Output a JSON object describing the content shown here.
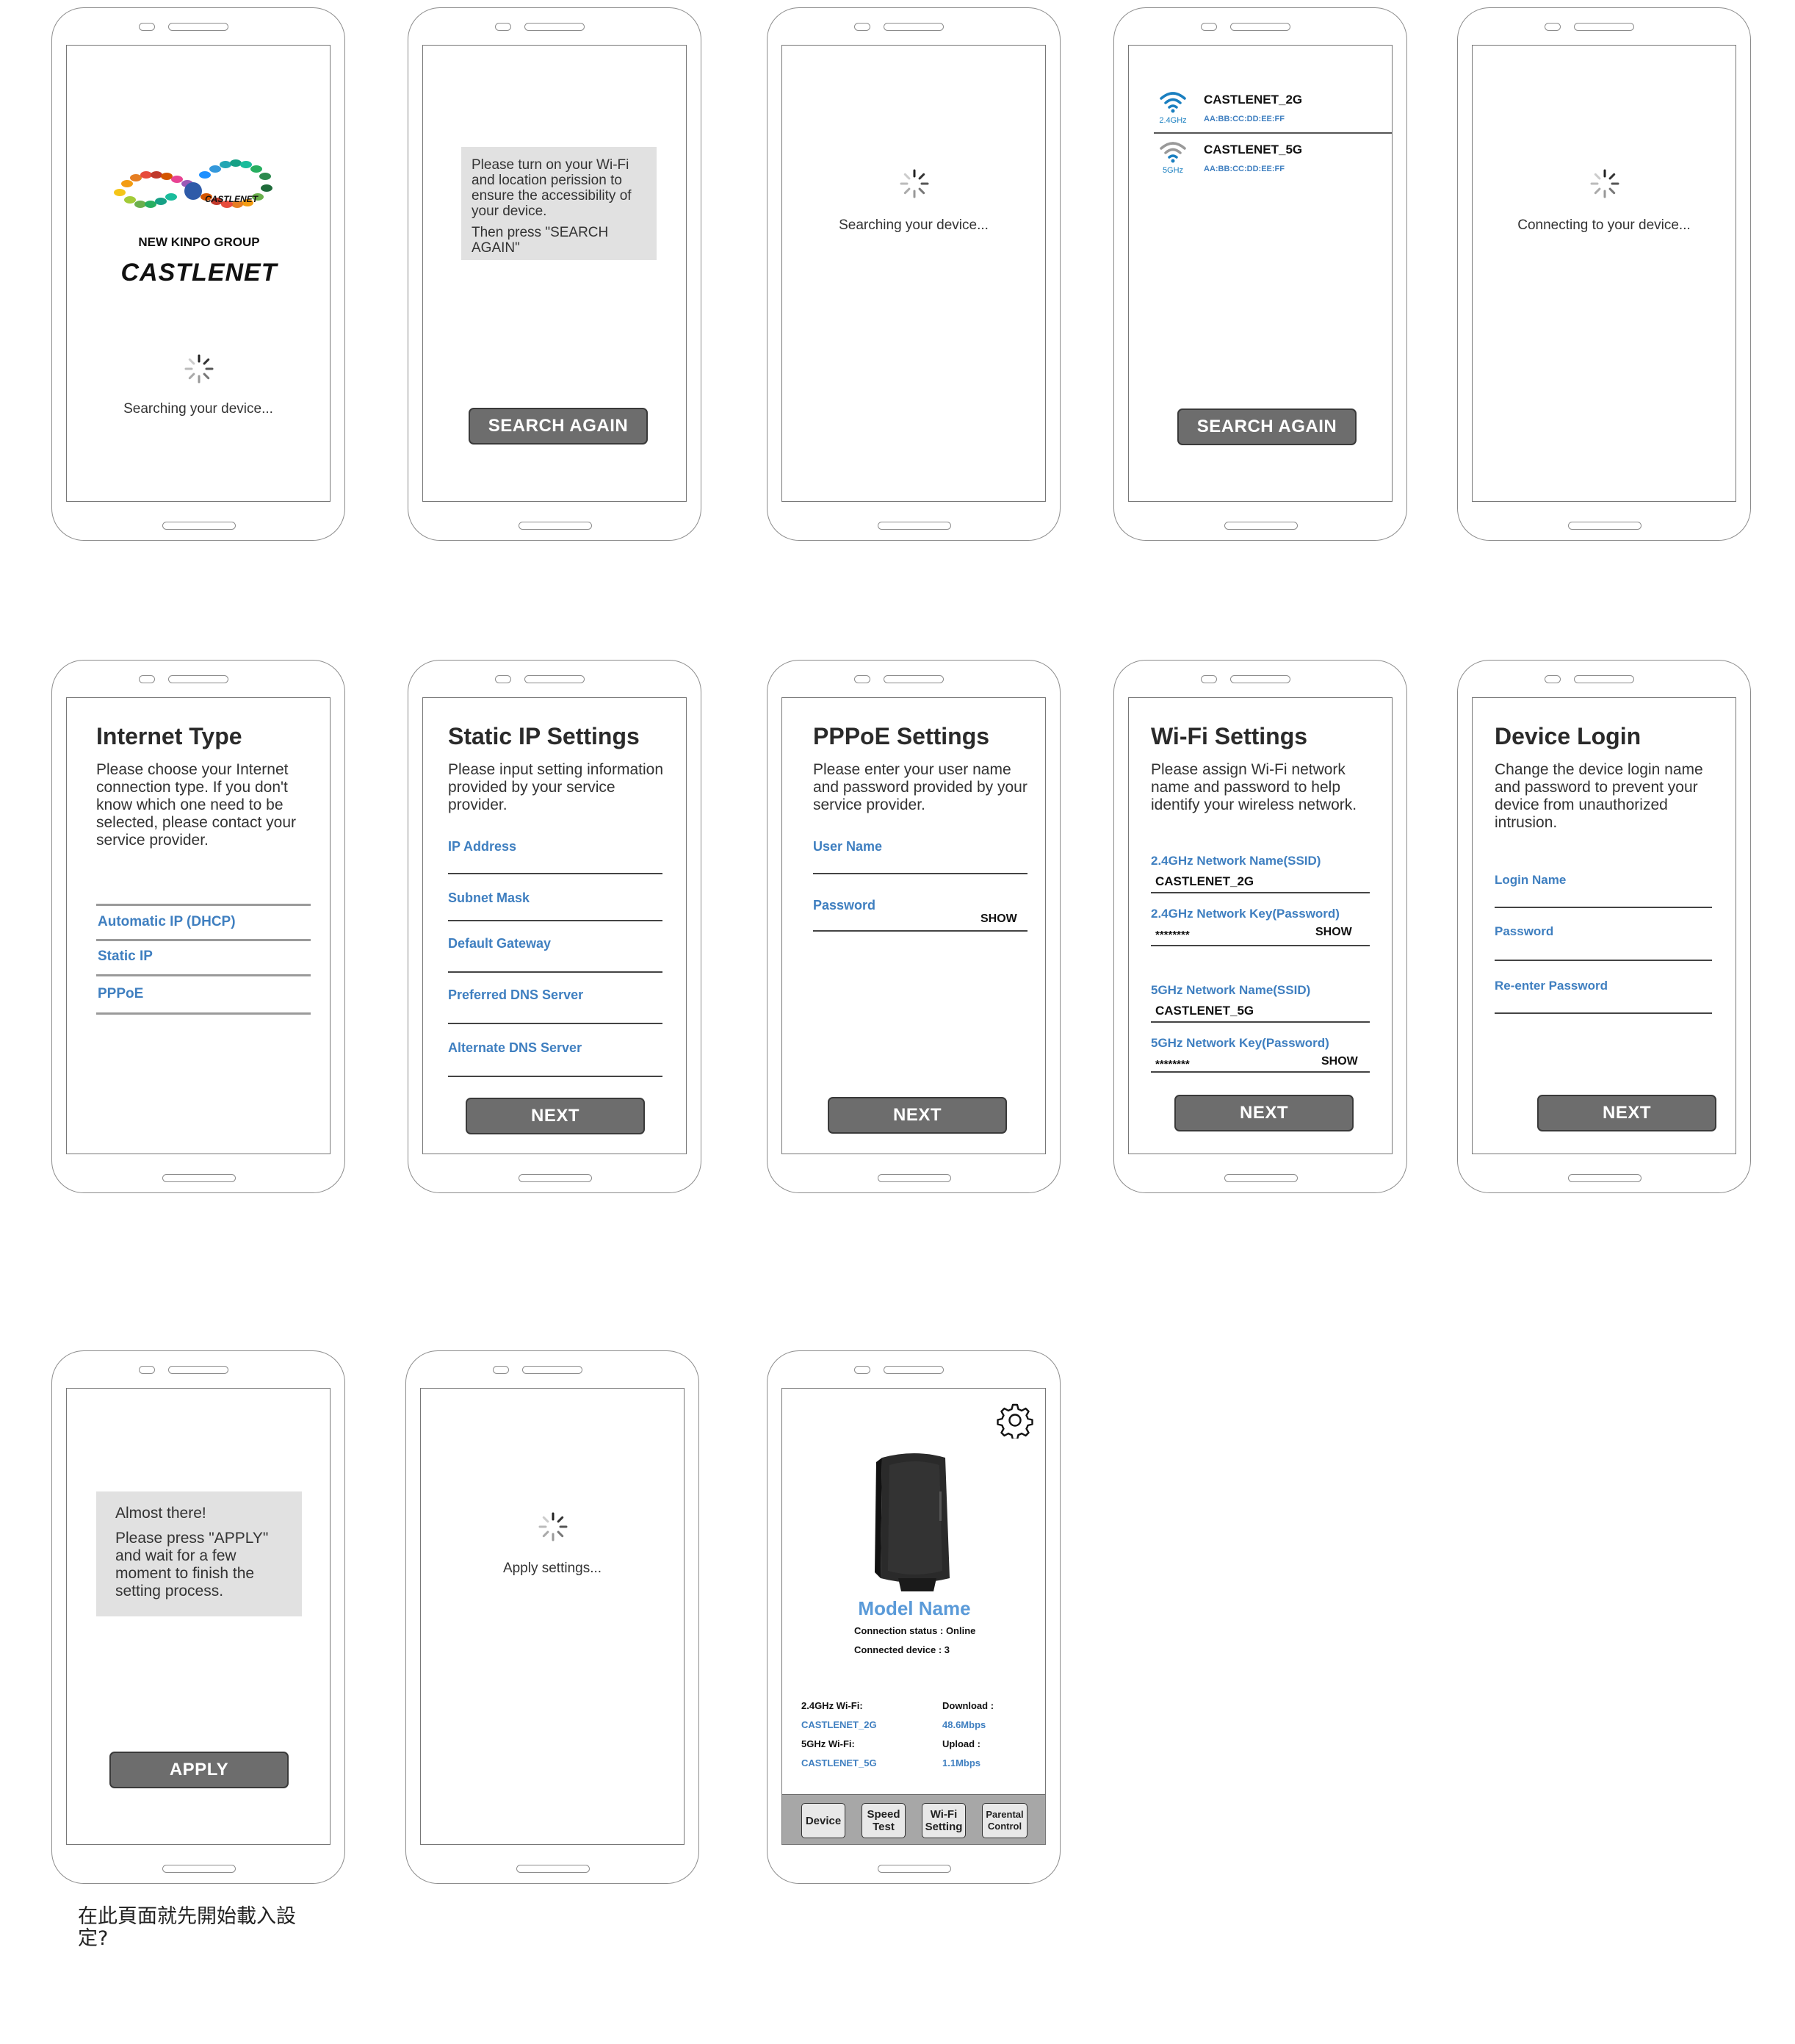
{
  "splash": {
    "logo_group_text": "NEW KINPO GROUP",
    "logo_brand_text": "CASTLENET",
    "logo_small_text": "CASTLENET",
    "status": "Searching your device..."
  },
  "permission": {
    "message": "Please turn on your Wi-Fi and location perission to ensure the accessibility of your device.",
    "instruction": "Then press \"SEARCH AGAIN\"",
    "button": "SEARCH AGAIN"
  },
  "searching": {
    "status": "Searching your device..."
  },
  "device_list": {
    "devices": [
      {
        "band": "2.4GHz",
        "name": "CASTLENET_2G",
        "mac": "AA:BB:CC:DD:EE:FF"
      },
      {
        "band": "5GHz",
        "name": "CASTLENET_5G",
        "mac": "AA:BB:CC:DD:EE:FF"
      }
    ],
    "button": "SEARCH AGAIN"
  },
  "connecting": {
    "status": "Connecting to your device..."
  },
  "internet_type": {
    "title": "Internet Type",
    "description": "Please choose your Internet connection type. If you don't know which one need to be selected, please contact your service provider.",
    "options": [
      "Automatic IP (DHCP)",
      "Static IP",
      "PPPoE"
    ]
  },
  "static_ip": {
    "title": "Static IP Settings",
    "description": "Please input setting information provided by your service provider.",
    "fields": [
      "IP Address",
      "Subnet Mask",
      "Default Gateway",
      "Preferred DNS Server",
      "Alternate DNS Server"
    ],
    "button": "NEXT"
  },
  "pppoe": {
    "title": "PPPoE Settings",
    "description": "Please enter your user name and password provided by your service provider.",
    "user_label": "User Name",
    "password_label": "Password",
    "show": "SHOW",
    "button": "NEXT"
  },
  "wifi": {
    "title": "Wi-Fi Settings",
    "description": "Please assign Wi-Fi network name and password to help identify your wireless network.",
    "ssid_24_label": "2.4GHz Network Name(SSID)",
    "ssid_24_value": "CASTLENET_2G",
    "key_24_label": "2.4GHz Network Key(Password)",
    "key_24_value": "********",
    "ssid_5_label": "5GHz Network Name(SSID)",
    "ssid_5_value": "CASTLENET_5G",
    "key_5_label": "5GHz Network Key(Password)",
    "key_5_value": "********",
    "show": "SHOW",
    "button": "NEXT"
  },
  "device_login": {
    "title": "Device Login",
    "description": "Change the device login name and password to prevent your device from unauthorized intrusion.",
    "fields": [
      "Login Name",
      "Password",
      "Re-enter Password"
    ],
    "button": "NEXT"
  },
  "almost": {
    "heading": "Almost there!",
    "message": "Please press \"APPLY\" and wait for a few moment to finish the setting process.",
    "button": "APPLY"
  },
  "applying": {
    "status": "Apply settings..."
  },
  "dashboard": {
    "model_name": "Model Name",
    "connection_status": "Connection status : Online",
    "connected_device": "Connected device : 3",
    "wifi24_label": "2.4GHz Wi-Fi:",
    "wifi24_value": "CASTLENET_2G",
    "wifi5_label": "5GHz Wi-Fi:",
    "wifi5_value": "CASTLENET_5G",
    "download_label": "Download :",
    "download_value": "48.6Mbps",
    "upload_label": "Upload :",
    "upload_value": "1.1Mbps",
    "tabs": [
      {
        "line1": "Device",
        "line2": ""
      },
      {
        "line1": "Speed",
        "line2": "Test"
      },
      {
        "line1": "Wi-Fi",
        "line2": "Setting"
      },
      {
        "line1": "Parental",
        "line2": "Control"
      }
    ]
  },
  "note": {
    "line1": "在此頁面就先開始載入設",
    "line2": "定?"
  },
  "colors": {
    "accent_blue": "#3f7fc0",
    "button_grey": "#6d6d6d",
    "box_grey": "#e1e1e1"
  },
  "icons": [
    "spinner-icon",
    "wifi-icon",
    "gear-icon",
    "router-image"
  ]
}
